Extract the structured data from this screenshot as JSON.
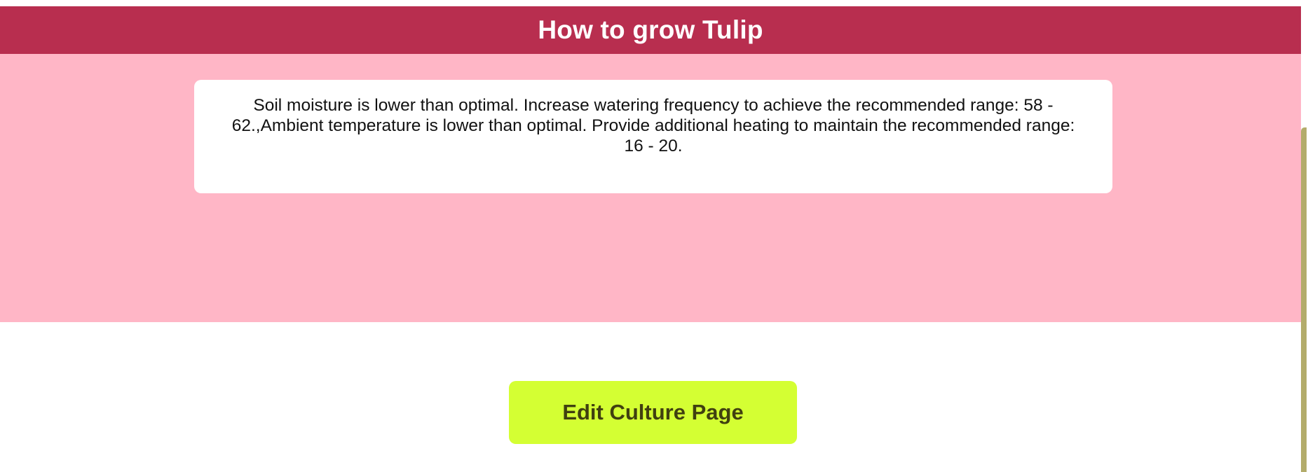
{
  "header": {
    "title": "How to grow Tulip"
  },
  "advice": {
    "text": "Soil moisture is lower than optimal. Increase watering frequency to achieve the recommended range: 58 - 62.,Ambient temperature is lower than optimal. Provide additional heating to maintain the recommended range: 16 - 20."
  },
  "actions": {
    "edit_label": "Edit Culture Page"
  },
  "colors": {
    "header_bg": "#b82e4f",
    "section_bg": "#ffb6c6",
    "button_bg": "#d4ff33",
    "button_text": "#404010",
    "scrollbar_thumb": "#b3ac6b"
  }
}
